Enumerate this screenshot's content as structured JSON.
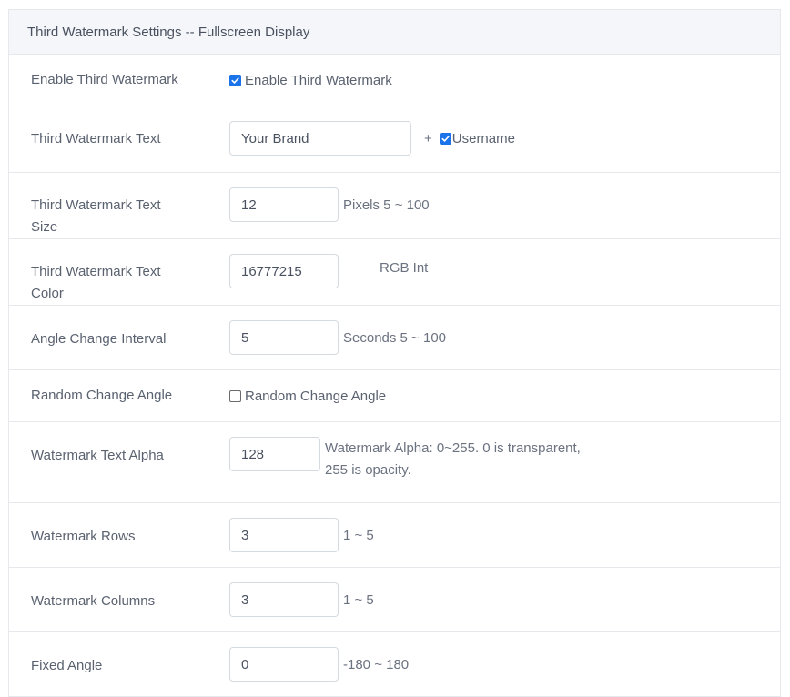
{
  "panel": {
    "title": "Third Watermark Settings -- Fullscreen Display"
  },
  "rows": {
    "enable": {
      "label": "Enable Third Watermark",
      "checkbox_label": "Enable Third Watermark",
      "checked": true
    },
    "text": {
      "label": "Third Watermark Text",
      "value": "Your Brand",
      "plus": "+",
      "username_label": "Username",
      "username_checked": true
    },
    "text_size": {
      "label": "Third Watermark Text Size",
      "value": "12",
      "hint": "Pixels 5 ~ 100"
    },
    "text_color": {
      "label": "Third Watermark Text Color",
      "value": "16777215",
      "hint": "RGB Int"
    },
    "angle_interval": {
      "label": "Angle Change Interval",
      "value": "5",
      "hint": "Seconds 5 ~ 100"
    },
    "random_angle": {
      "label": "Random Change Angle",
      "checkbox_label": "Random Change Angle",
      "checked": false
    },
    "alpha": {
      "label": "Watermark Text Alpha",
      "value": "128",
      "hint": "Watermark Alpha: 0~255. 0 is transparent, 255 is opacity."
    },
    "rows_count": {
      "label": "Watermark Rows",
      "value": "3",
      "hint": "1 ~ 5"
    },
    "columns_count": {
      "label": "Watermark Columns",
      "value": "3",
      "hint": "1 ~ 5"
    },
    "fixed_angle": {
      "label": "Fixed Angle",
      "value": "0",
      "hint": "-180 ~ 180"
    }
  },
  "colors": {
    "accent": "#1a73e8",
    "header_bg": "#f5f6fa",
    "border": "#e6e8ec",
    "text": "#5a6270"
  },
  "icons": {
    "checkbox_checked": "checkmark-icon"
  }
}
